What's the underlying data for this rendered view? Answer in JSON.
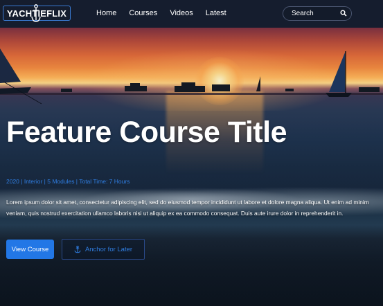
{
  "brand": {
    "logo_text": "YACHTIEFLIX"
  },
  "nav": {
    "items": [
      {
        "label": "Home"
      },
      {
        "label": "Courses"
      },
      {
        "label": "Videos"
      },
      {
        "label": "Latest"
      }
    ]
  },
  "search": {
    "placeholder": "Search",
    "icon": "search-icon"
  },
  "hero": {
    "title": "Feature Course Title",
    "meta": "2020 | Interior | 5 Modules | Total Time: 7 Hours",
    "description": "Lorem ipsum dolor sit amet, consectetur adipiscing elit, sed do eiusmod tempor incididunt ut labore et dolore magna aliqua. Ut enim ad minim veniam, quis nostrud exercitation ullamco laboris nisi ut aliquip ex ea commodo consequat. Duis aute irure dolor in reprehenderit in.",
    "primary_button": "View Course",
    "secondary_button": "Anchor for Later",
    "secondary_icon": "anchor-icon"
  },
  "colors": {
    "navbar_bg": "#151d2e",
    "accent_blue": "#2277e6",
    "meta_text": "#2f7de0"
  }
}
